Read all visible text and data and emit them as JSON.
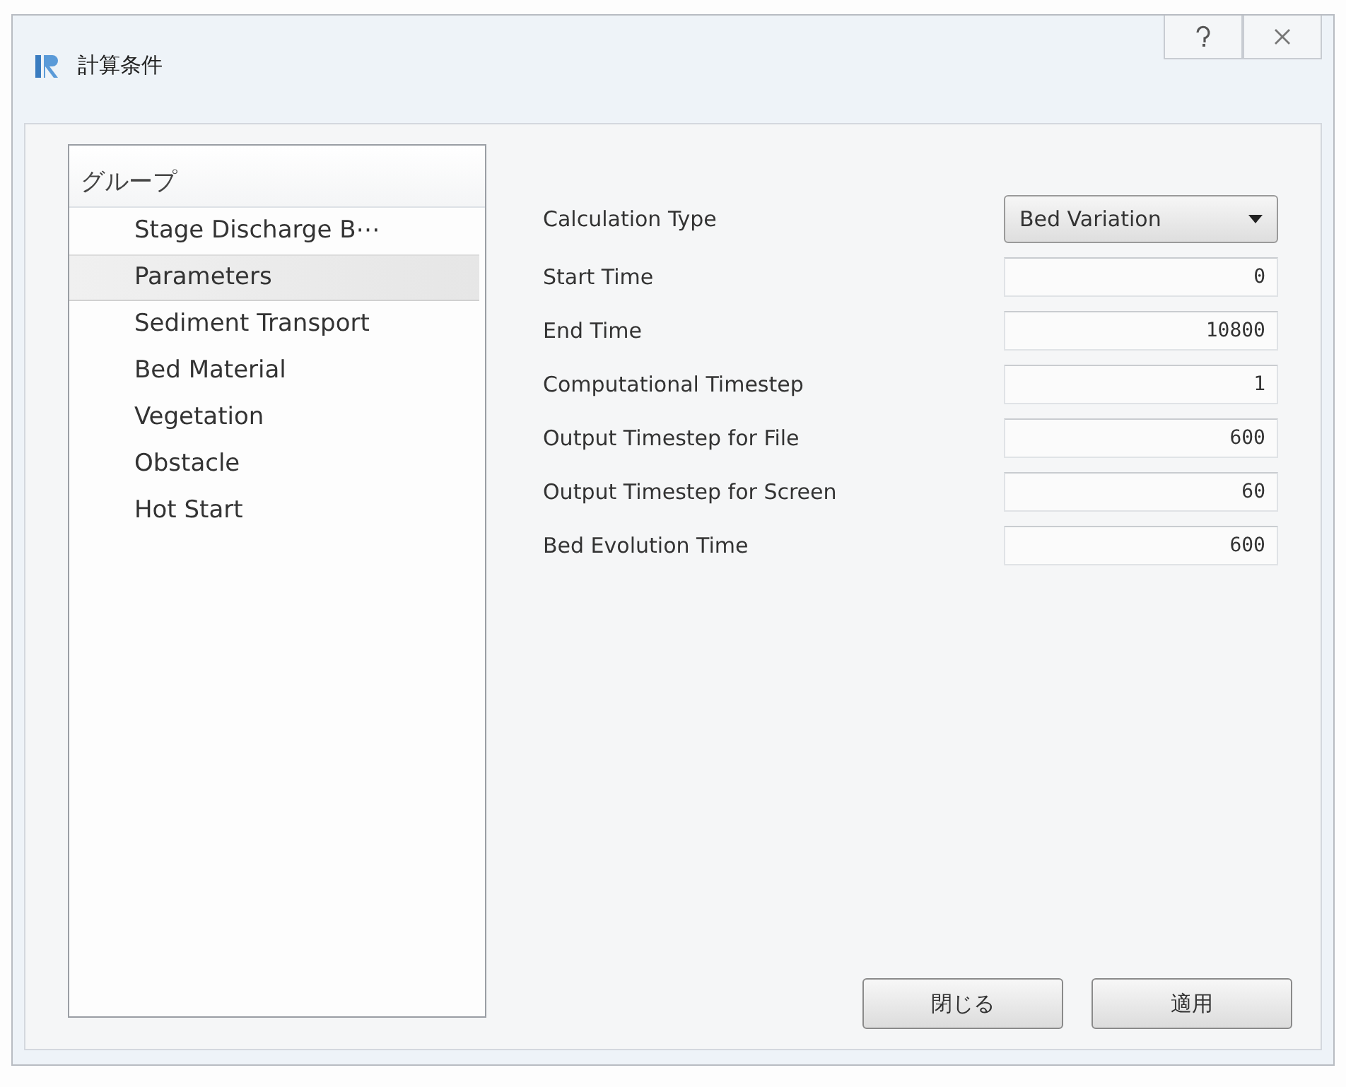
{
  "window": {
    "title": "計算条件"
  },
  "group_list": {
    "header": "グループ",
    "items": [
      {
        "label": "Stage Discharge B⋯",
        "selected": false
      },
      {
        "label": "Parameters",
        "selected": true
      },
      {
        "label": "Sediment Transport",
        "selected": false
      },
      {
        "label": "Bed Material",
        "selected": false
      },
      {
        "label": "Vegetation",
        "selected": false
      },
      {
        "label": "Obstacle",
        "selected": false
      },
      {
        "label": "Hot Start",
        "selected": false
      }
    ]
  },
  "fields": [
    {
      "kind": "dropdown",
      "label": "Calculation Type",
      "value": "Bed Variation"
    },
    {
      "kind": "number",
      "label": "Start Time",
      "value": "0"
    },
    {
      "kind": "number",
      "label": "End Time",
      "value": "10800"
    },
    {
      "kind": "number",
      "label": "Computational Timestep",
      "value": "1"
    },
    {
      "kind": "number",
      "label": "Output Timestep for File",
      "value": "600"
    },
    {
      "kind": "number",
      "label": "Output Timestep for Screen",
      "value": "60"
    },
    {
      "kind": "number",
      "label": "Bed Evolution Time",
      "value": "600"
    }
  ],
  "buttons": [
    "閉じる",
    "適用"
  ]
}
